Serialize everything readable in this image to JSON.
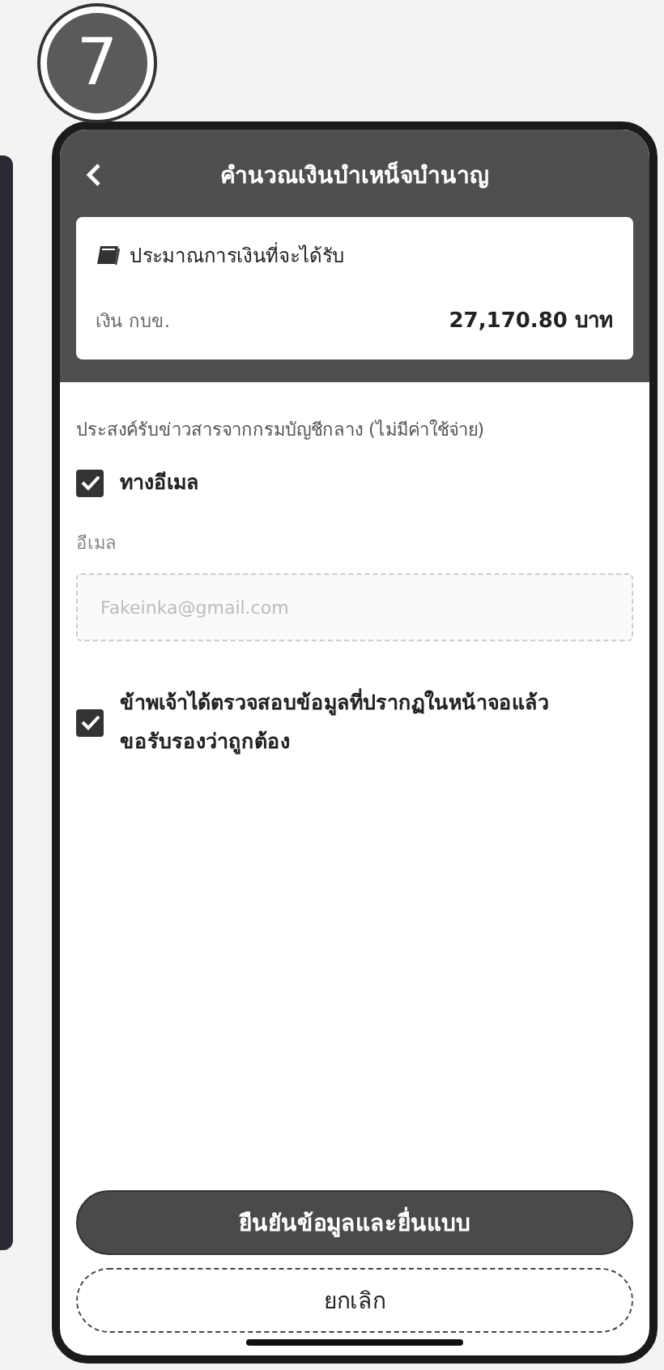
{
  "step_badge": "7",
  "header": {
    "title": "คำนวณเงินบำเหน็จบำนาญ"
  },
  "estimate_card": {
    "title": "ประมาณการเงินที่จะได้รับ",
    "label": "เงิน กบข.",
    "amount": "27,170.80 บาท"
  },
  "news_prompt": "ประสงค์รับข่าวสารจากกรมบัญชีกลาง (ไม่มีค่าใช้จ่าย)",
  "email_option": {
    "label": "ทางอีเมล",
    "checked": true
  },
  "email_field": {
    "label": "อีเมล",
    "value": "Fakeinka@gmail.com",
    "disabled": true
  },
  "confirm": {
    "label": "ข้าพเจ้าได้ตรวจสอบข้อมูลที่ปรากฏในหน้าจอแล้ว ขอรับรองว่าถูกต้อง",
    "checked": true
  },
  "buttons": [
    {
      "label": "ยืนยันข้อมูลและยื่นแบบ",
      "kind": "primary"
    },
    {
      "label": "ยกเลิก",
      "kind": "secondary"
    }
  ]
}
